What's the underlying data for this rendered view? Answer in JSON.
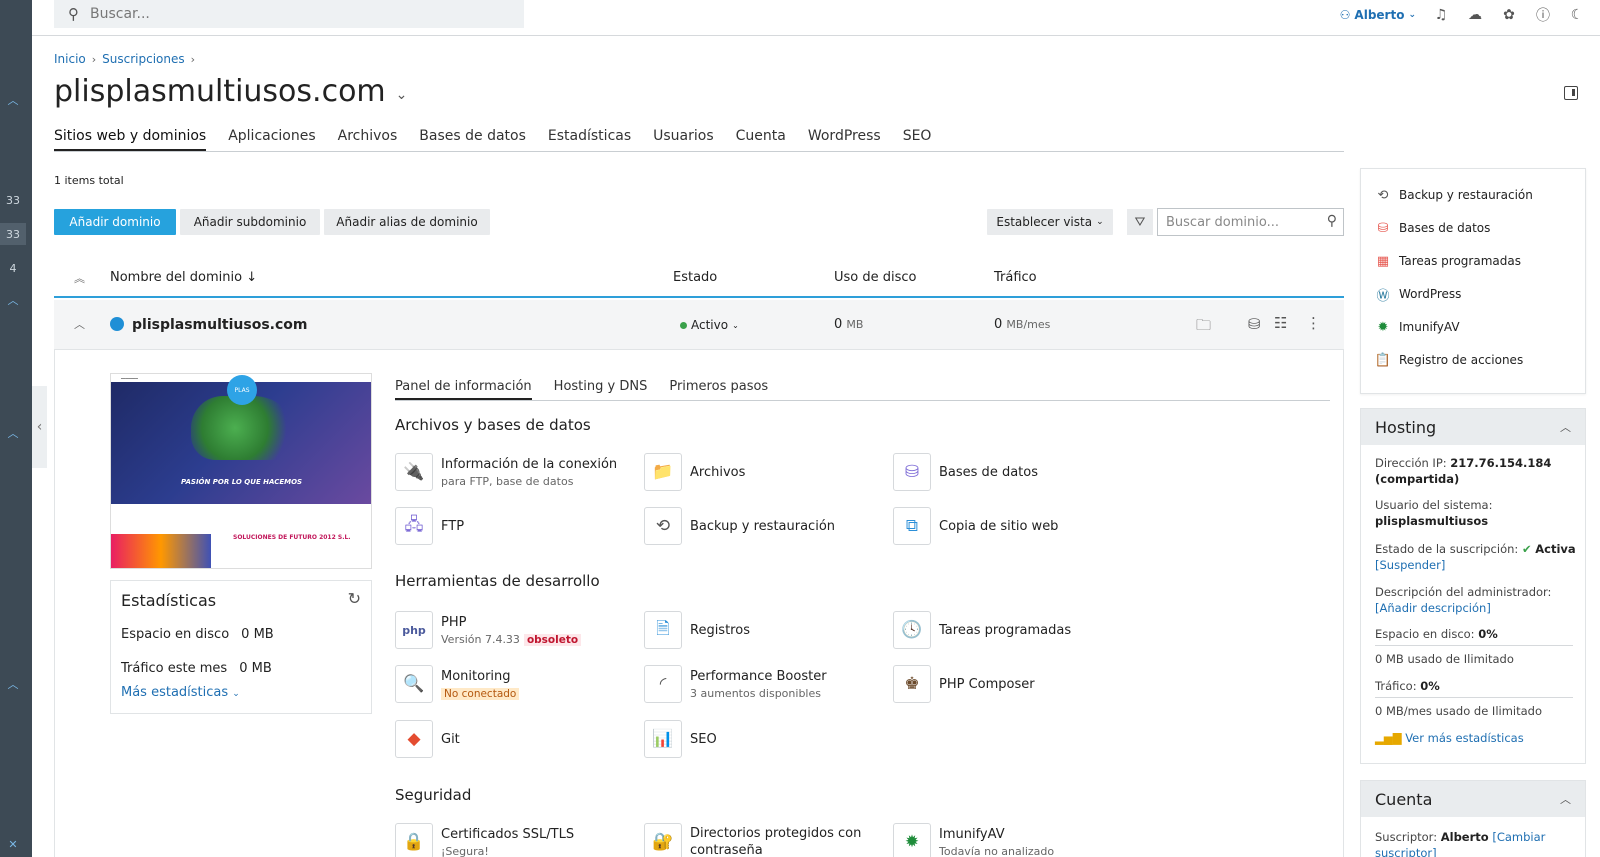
{
  "leftbar": {
    "items": [
      "33",
      "33",
      "4"
    ]
  },
  "topbar": {
    "search_placeholder": "Buscar...",
    "user": "Alberto"
  },
  "breadcrumb": [
    "Inicio",
    "Suscripciones"
  ],
  "page_title": "plisplasmultiusos.com",
  "main_tabs": [
    "Sitios web y dominios",
    "Aplicaciones",
    "Archivos",
    "Bases de datos",
    "Estadísticas",
    "Usuarios",
    "Cuenta",
    "WordPress",
    "SEO"
  ],
  "items_total": "1 items total",
  "toolbar": {
    "add_domain": "Añadir dominio",
    "add_subdomain": "Añadir subdominio",
    "add_alias": "Añadir alias de dominio",
    "set_view": "Establecer vista",
    "domain_search_placeholder": "Buscar dominio..."
  },
  "columns": {
    "name": "Nombre del dominio ↓",
    "status": "Estado",
    "disk": "Uso de disco",
    "traffic": "Tráfico"
  },
  "domain": {
    "name": "plisplasmultiusos.com",
    "status": "Activo",
    "disk_value": "0",
    "disk_unit": "MB",
    "traffic_value": "0",
    "traffic_unit": "MB/mes"
  },
  "preview": {
    "hero_text": "PASIÓN POR LO QUE HACEMOS",
    "logo_text": "PLAS",
    "bottom_text": "SOLUCIONES DE FUTURO 2012 S.L."
  },
  "stats": {
    "title": "Estadísticas",
    "disk_label": "Espacio en disco",
    "disk_value": "0 MB",
    "traffic_label": "Tráfico este mes",
    "traffic_value": "0 MB",
    "more": "Más estadísticas"
  },
  "dash_tabs": [
    "Panel de información",
    "Hosting y DNS",
    "Primeros pasos"
  ],
  "sections": {
    "files_db": "Archivos y bases de datos",
    "dev_tools": "Herramientas de desarrollo",
    "security": "Seguridad"
  },
  "tools": {
    "connection": {
      "name": "Información de la conexión",
      "sub": "para FTP, base de datos"
    },
    "files": {
      "name": "Archivos"
    },
    "databases": {
      "name": "Bases de datos"
    },
    "ftp": {
      "name": "FTP"
    },
    "backup": {
      "name": "Backup y restauración"
    },
    "copy_site": {
      "name": "Copia de sitio web"
    },
    "php": {
      "name": "PHP",
      "sub": "Versión 7.4.33",
      "tag": "obsoleto"
    },
    "logs": {
      "name": "Registros"
    },
    "scheduled": {
      "name": "Tareas programadas"
    },
    "monitoring": {
      "name": "Monitoring",
      "tag": "No conectado"
    },
    "perf": {
      "name": "Performance Booster",
      "sub": "3 aumentos disponibles"
    },
    "composer": {
      "name": "PHP Composer"
    },
    "git": {
      "name": "Git"
    },
    "seo": {
      "name": "SEO"
    },
    "ssl": {
      "name": "Certificados SSL/TLS",
      "sub": "¡Segura!"
    },
    "protected_dirs": {
      "name": "Directorios protegidos con contraseña"
    },
    "imunify": {
      "name": "ImunifyAV",
      "sub": "Todavía no analizado"
    }
  },
  "quick_links": [
    "Backup y restauración",
    "Bases de datos",
    "Tareas programadas",
    "WordPress",
    "ImunifyAV",
    "Registro de acciones"
  ],
  "hosting": {
    "title": "Hosting",
    "ip_label": "Dirección IP:",
    "ip_value": "217.76.154.184",
    "ip_note": "(compartida)",
    "sysuser_label": "Usuario del sistema:",
    "sysuser_value": "plisplasmultiusos",
    "sub_status_label": "Estado de la suscripción:",
    "sub_status_value": "Activa",
    "suspend": "[Suspender]",
    "admin_desc_label": "Descripción del administrador:",
    "admin_desc_link": "[Añadir descripción]",
    "disk_label": "Espacio en disco:",
    "disk_value": "0%",
    "disk_used": "0 MB usado de Ilimitado",
    "traffic_label": "Tráfico:",
    "traffic_value": "0%",
    "traffic_used": "0 MB/mes usado de Ilimitado",
    "more_stats": "Ver más estadísticas"
  },
  "account": {
    "title": "Cuenta",
    "subscriber_label": "Suscriptor:",
    "subscriber_value": "Alberto",
    "change_link": "[Cambiar suscriptor]"
  }
}
